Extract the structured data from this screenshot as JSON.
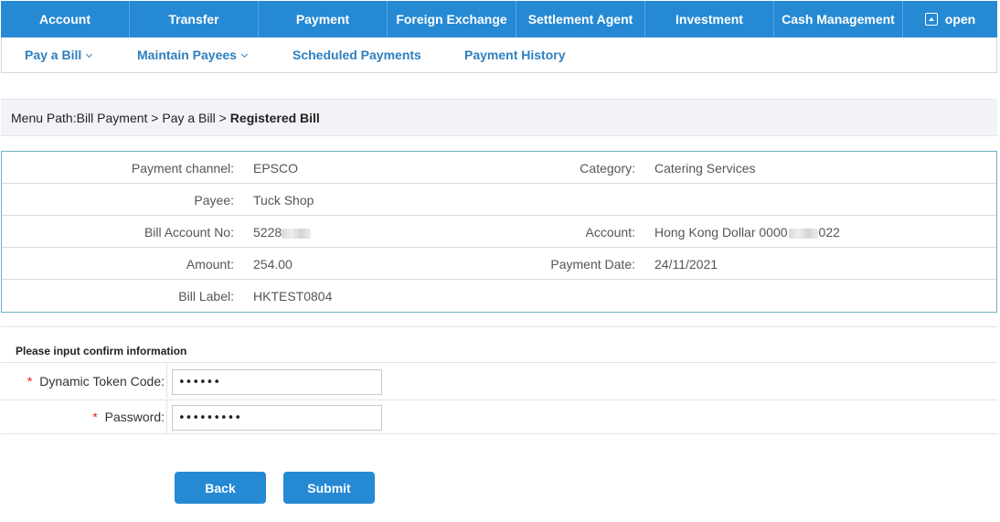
{
  "topnav": {
    "items": [
      "Account",
      "Transfer",
      "Payment",
      "Foreign Exchange",
      "Settlement Agent",
      "Investment",
      "Cash Management"
    ],
    "open_label": "open"
  },
  "subnav": {
    "items": [
      "Pay a Bill",
      "Maintain Payees",
      "Scheduled Payments",
      "Payment History"
    ]
  },
  "breadcrumb": {
    "path": "Menu Path:Bill Payment > Pay a Bill >",
    "current": "Registered Bill"
  },
  "details": {
    "payment_channel_label": "Payment channel:",
    "payment_channel": "EPSCO",
    "category_label": "Category:",
    "category": "Catering Services",
    "payee_label": "Payee:",
    "payee": "Tuck Shop",
    "bill_account_label": "Bill Account No:",
    "bill_account_prefix": "5228",
    "account_label": "Account:",
    "account_prefix": "Hong Kong Dollar 0000",
    "account_suffix": "022",
    "amount_label": "Amount:",
    "amount": "254.00",
    "payment_date_label": "Payment Date:",
    "payment_date": "24/11/2021",
    "bill_label_label": "Bill Label:",
    "bill_label": "HKTEST0804"
  },
  "confirm": {
    "title": "Please input confirm information",
    "required_mark": "*",
    "token_label": "Dynamic Token Code:",
    "token_value": "••••••",
    "password_label": "Password:",
    "password_value": "•••••••••"
  },
  "buttons": {
    "back": "Back",
    "submit": "Submit"
  },
  "colors": {
    "primary": "#2589d4",
    "link": "#2d7fc0",
    "required": "#e02020"
  }
}
